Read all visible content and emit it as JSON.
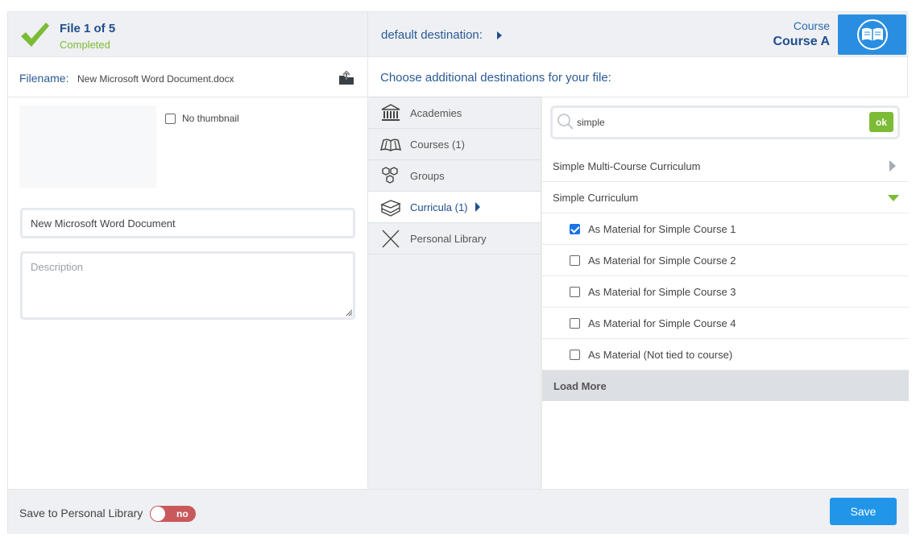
{
  "header": {
    "file_count": "File 1 of 5",
    "file_status": "Completed",
    "destination_label": "default destination:",
    "course_label": "Course",
    "course_name": "Course A"
  },
  "file": {
    "filename_label": "Filename:",
    "filename_value": "New Microsoft Word Document.docx",
    "no_thumbnail_label": "No thumbnail",
    "no_thumbnail_checked": false,
    "title_value": "New Microsoft Word Document",
    "description_placeholder": "Description"
  },
  "destinations": {
    "heading": "Choose additional destinations for your file:",
    "categories": [
      {
        "label": "Academies",
        "icon": "academy-icon",
        "active": false
      },
      {
        "label": "Courses (1)",
        "icon": "book-icon",
        "active": false
      },
      {
        "label": "Groups",
        "icon": "groups-icon",
        "active": false
      },
      {
        "label": "Curricula (1)",
        "icon": "books-stack-icon",
        "active": true
      },
      {
        "label": "Personal Library",
        "icon": "personal-library-icon",
        "active": false
      }
    ],
    "search_value": "simple",
    "ok_label": "ok",
    "curricula": [
      {
        "label": "Simple Multi-Course Curriculum",
        "expanded": false
      },
      {
        "label": "Simple Curriculum",
        "expanded": true
      }
    ],
    "materials": [
      {
        "label": "As Material for Simple Course 1",
        "checked": true
      },
      {
        "label": "As Material for Simple Course 2",
        "checked": false
      },
      {
        "label": "As Material for Simple Course 3",
        "checked": false
      },
      {
        "label": "As Material for Simple Course 4",
        "checked": false
      },
      {
        "label": "As Material (Not tied to course)",
        "checked": false
      }
    ],
    "load_more_label": "Load More"
  },
  "footer": {
    "save_personal_label": "Save to Personal Library",
    "toggle_label": "no",
    "save_label": "Save"
  },
  "colors": {
    "accent_blue": "#2196e8",
    "success_green": "#7cbb35",
    "toggle_off_red": "#c9595b",
    "title_blue": "#1f4e8c"
  }
}
